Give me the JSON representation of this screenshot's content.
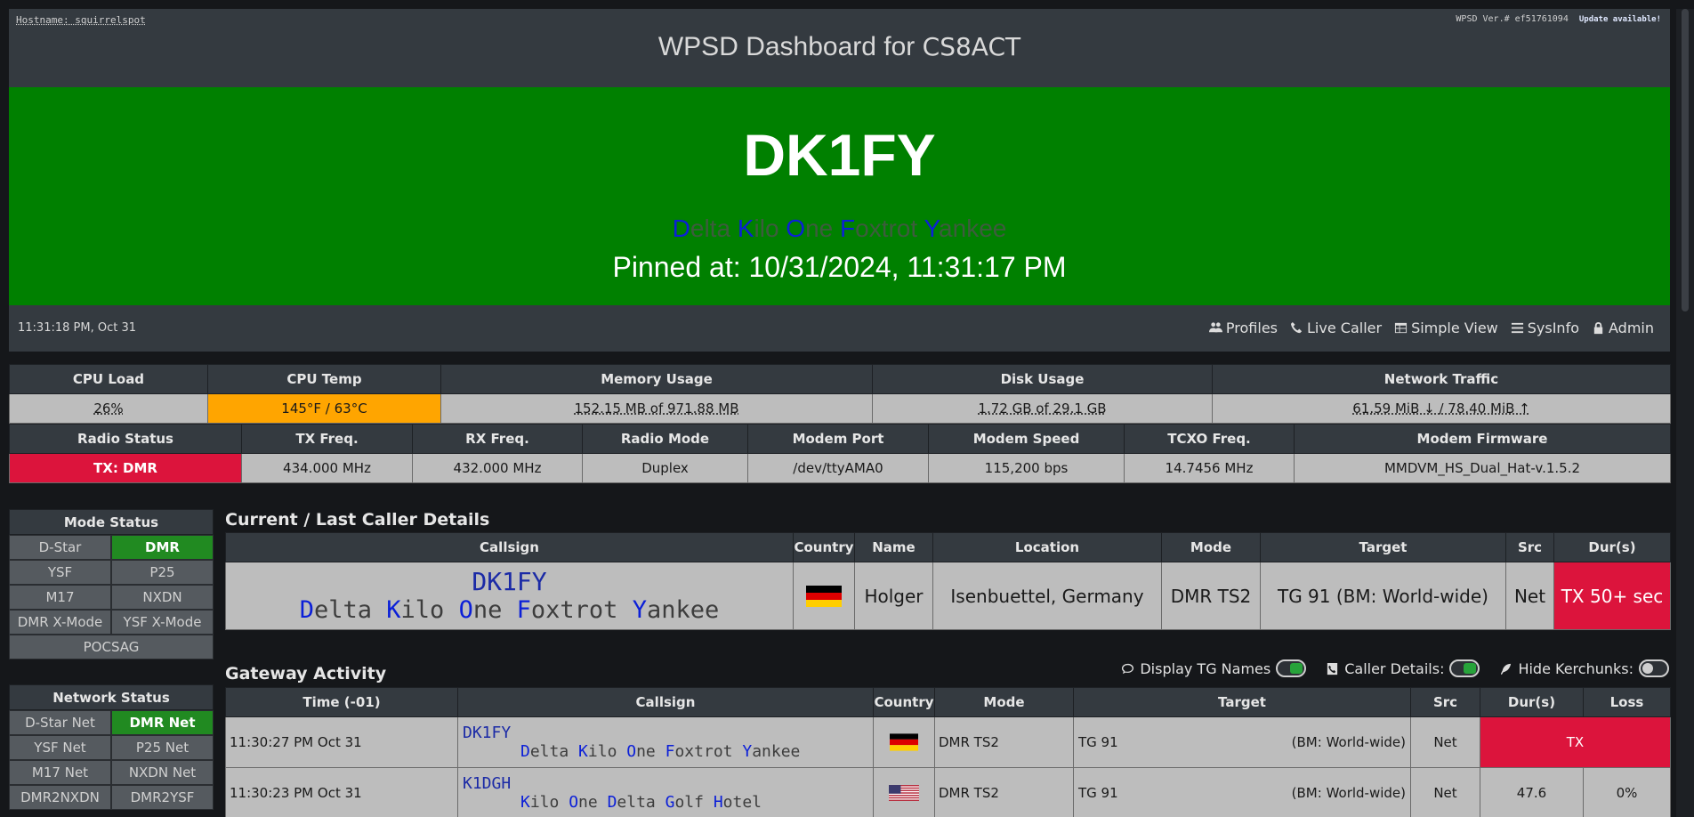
{
  "header": {
    "hostname": "Hostname: squirrelspot",
    "version": "WPSD Ver.# ef51761094",
    "update": "Update available!",
    "title_prefix": "WPSD Dashboard for",
    "title_callsign": "CS8ACT"
  },
  "banner": {
    "callsign": "DK1FY",
    "phonetic": [
      {
        "first": "D",
        "rest": "elta"
      },
      {
        "first": "K",
        "rest": "ilo"
      },
      {
        "first": "O",
        "rest": "ne"
      },
      {
        "first": "F",
        "rest": "oxtrot"
      },
      {
        "first": "Y",
        "rest": "ankee"
      }
    ],
    "pinned": "Pinned at: 10/31/2024, 11:31:17 PM",
    "color": "#008000"
  },
  "nav": {
    "clock": "11:31:18 PM, Oct 31",
    "links": [
      "Profiles",
      "Live Caller",
      "Simple View",
      "SysInfo",
      "Admin"
    ]
  },
  "system": {
    "headers": [
      "CPU Load",
      "CPU Temp",
      "Memory Usage",
      "Disk Usage",
      "Network Traffic"
    ],
    "cpu_load": "26%",
    "cpu_temp": "145°F / 63°C",
    "memory": "152.15 MB of 971.88 MB",
    "disk": "1.72 GB of 29.1 GB",
    "network": "61.59 MiB ↓ / 78.40 MiB ↑"
  },
  "radio": {
    "headers": [
      "Radio Status",
      "TX Freq.",
      "RX Freq.",
      "Radio Mode",
      "Modem Port",
      "Modem Speed",
      "TCXO Freq.",
      "Modem Firmware"
    ],
    "status": "TX: DMR",
    "tx_freq": "434.000 MHz",
    "rx_freq": "432.000 MHz",
    "mode": "Duplex",
    "port": "/dev/ttyAMA0",
    "speed": "115,200 bps",
    "tcxo": "14.7456 MHz",
    "firmware": "MMDVM_HS_Dual_Hat-v.1.5.2"
  },
  "mode_status": {
    "title": "Mode Status",
    "items": [
      {
        "label": "D-Star",
        "on": false
      },
      {
        "label": "DMR",
        "on": true
      },
      {
        "label": "YSF",
        "on": false
      },
      {
        "label": "P25",
        "on": false
      },
      {
        "label": "M17",
        "on": false
      },
      {
        "label": "NXDN",
        "on": false
      },
      {
        "label": "DMR X-Mode",
        "on": false
      },
      {
        "label": "YSF X-Mode",
        "on": false
      },
      {
        "label": "POCSAG",
        "on": false
      }
    ]
  },
  "network_status": {
    "title": "Network Status",
    "items": [
      {
        "label": "D-Star Net",
        "on": false
      },
      {
        "label": "DMR Net",
        "on": true
      },
      {
        "label": "YSF Net",
        "on": false
      },
      {
        "label": "P25 Net",
        "on": false
      },
      {
        "label": "M17 Net",
        "on": false
      },
      {
        "label": "NXDN Net",
        "on": false
      },
      {
        "label": "DMR2NXDN",
        "on": false
      },
      {
        "label": "DMR2YSF",
        "on": false
      }
    ]
  },
  "current": {
    "title": "Current / Last Caller Details",
    "headers": [
      "Callsign",
      "Country",
      "Name",
      "Location",
      "Mode",
      "Target",
      "Src",
      "Dur(s)"
    ],
    "callsign": "DK1FY",
    "phonetic": [
      {
        "first": "D",
        "rest": "elta"
      },
      {
        "first": "K",
        "rest": "ilo"
      },
      {
        "first": "O",
        "rest": "ne"
      },
      {
        "first": "F",
        "rest": "oxtrot"
      },
      {
        "first": "Y",
        "rest": "ankee"
      }
    ],
    "country_icon": "germany-flag-icon",
    "name": "Holger",
    "location": "Isenbuettel, Germany",
    "mode": "DMR TS2",
    "target": "TG 91 (BM: World-wide)",
    "src": "Net",
    "duration": "TX 50+ sec"
  },
  "gateway": {
    "title": "Gateway Activity",
    "toggles": [
      {
        "label": "Display TG Names",
        "on": true,
        "icon": "chat-icon"
      },
      {
        "label": "Caller Details:",
        "on": true,
        "icon": "phone-icon"
      },
      {
        "label": "Hide Kerchunks:",
        "on": false,
        "icon": "feather-icon"
      }
    ],
    "headers": [
      "Time (-01)",
      "Callsign",
      "Country",
      "Mode",
      "Target",
      "Src",
      "Dur(s)",
      "Loss"
    ],
    "rows": [
      {
        "time": "11:30:27 PM Oct 31",
        "callsign": "DK1FY",
        "phonetic": [
          {
            "first": "D",
            "rest": "elta"
          },
          {
            "first": "K",
            "rest": "ilo"
          },
          {
            "first": "O",
            "rest": "ne"
          },
          {
            "first": "F",
            "rest": "oxtrot"
          },
          {
            "first": "Y",
            "rest": "ankee"
          }
        ],
        "country_icon": "germany-flag-icon",
        "mode": "DMR TS2",
        "tg": "TG 91",
        "tg_name": "(BM: World-wide)",
        "src": "Net",
        "dur": "TX",
        "loss": ""
      },
      {
        "time": "11:30:23 PM Oct 31",
        "callsign": "K1DGH",
        "phonetic": [
          {
            "first": "K",
            "rest": "ilo"
          },
          {
            "first": "O",
            "rest": "ne"
          },
          {
            "first": "D",
            "rest": "elta"
          },
          {
            "first": "G",
            "rest": "olf"
          },
          {
            "first": "H",
            "rest": "otel"
          }
        ],
        "country_icon": "usa-flag-icon",
        "mode": "DMR TS2",
        "tg": "TG 91",
        "tg_name": "(BM: World-wide)",
        "src": "Net",
        "dur": "47.6",
        "loss": "0%"
      }
    ]
  }
}
